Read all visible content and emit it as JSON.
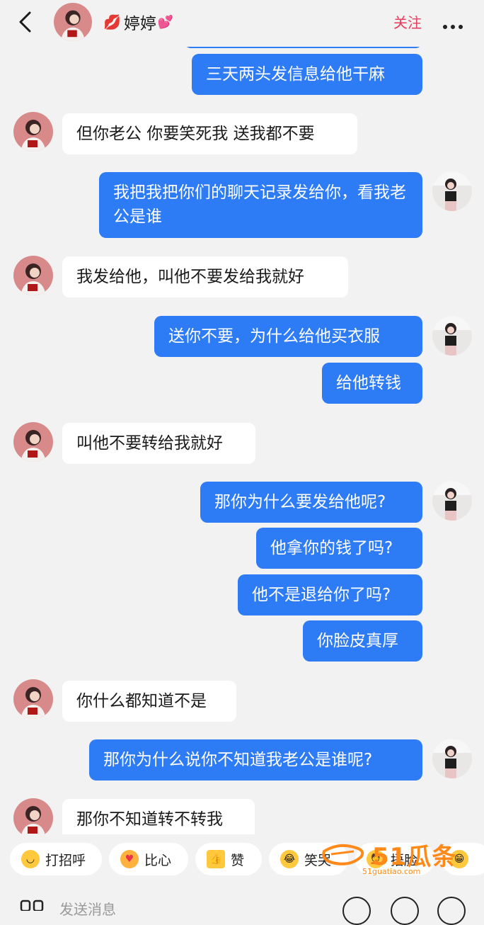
{
  "header": {
    "name": "婷婷",
    "follow_label": "关注"
  },
  "messages": [
    {
      "side": "mine",
      "text": "三天两头发信息给他干麻"
    },
    {
      "side": "theirs",
      "text": "但你老公 你要笑死我 送我都不要"
    },
    {
      "side": "mine",
      "text": "我把我把你们的聊天记录发给你，看我老公是谁"
    },
    {
      "side": "theirs",
      "text": "我发给他，叫他不要发给我就好"
    },
    {
      "side": "mine",
      "text": "送你不要，为什么给他买衣服"
    },
    {
      "side": "mine",
      "text": "给他转钱"
    },
    {
      "side": "theirs",
      "text": "叫他不要转给我就好"
    },
    {
      "side": "mine",
      "text": "那你为什么要发给他呢?"
    },
    {
      "side": "mine",
      "text": "他拿你的钱了吗?"
    },
    {
      "side": "mine",
      "text": "他不是退给你了吗?"
    },
    {
      "side": "mine",
      "text": "你脸皮真厚"
    },
    {
      "side": "theirs",
      "text": "你什么都知道不是"
    },
    {
      "side": "mine",
      "text": "那你为什么说你不知道我老公是谁呢?"
    },
    {
      "side": "theirs",
      "text": "那你不知道转不转我"
    }
  ],
  "quick_replies": [
    {
      "label": "打招呼",
      "icon": "greeting-emoji-icon"
    },
    {
      "label": "比心",
      "icon": "finger-heart-emoji-icon"
    },
    {
      "label": "赞",
      "icon": "thumbs-up-icon"
    },
    {
      "label": "笑哭",
      "icon": "tears-of-joy-emoji-icon"
    },
    {
      "label": "捂脸",
      "icon": "facepalm-emoji-icon"
    }
  ],
  "input": {
    "placeholder": "发送消息"
  },
  "watermark": {
    "brand": "51瓜条",
    "url": "51guatiao.com"
  },
  "colors": {
    "my_bubble": "#2e7bf6",
    "their_bubble": "#ffffff",
    "background": "#f2f2f2",
    "follow": "#e83a5a",
    "watermark": "#ff8a1a"
  }
}
